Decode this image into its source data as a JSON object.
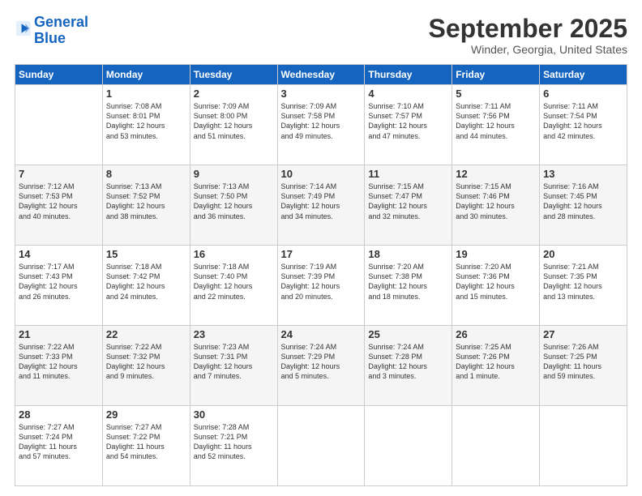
{
  "logo": {
    "line1": "General",
    "line2": "Blue"
  },
  "title": "September 2025",
  "subtitle": "Winder, Georgia, United States",
  "weekdays": [
    "Sunday",
    "Monday",
    "Tuesday",
    "Wednesday",
    "Thursday",
    "Friday",
    "Saturday"
  ],
  "weeks": [
    [
      {
        "num": "",
        "info": ""
      },
      {
        "num": "1",
        "info": "Sunrise: 7:08 AM\nSunset: 8:01 PM\nDaylight: 12 hours\nand 53 minutes."
      },
      {
        "num": "2",
        "info": "Sunrise: 7:09 AM\nSunset: 8:00 PM\nDaylight: 12 hours\nand 51 minutes."
      },
      {
        "num": "3",
        "info": "Sunrise: 7:09 AM\nSunset: 7:58 PM\nDaylight: 12 hours\nand 49 minutes."
      },
      {
        "num": "4",
        "info": "Sunrise: 7:10 AM\nSunset: 7:57 PM\nDaylight: 12 hours\nand 47 minutes."
      },
      {
        "num": "5",
        "info": "Sunrise: 7:11 AM\nSunset: 7:56 PM\nDaylight: 12 hours\nand 44 minutes."
      },
      {
        "num": "6",
        "info": "Sunrise: 7:11 AM\nSunset: 7:54 PM\nDaylight: 12 hours\nand 42 minutes."
      }
    ],
    [
      {
        "num": "7",
        "info": "Sunrise: 7:12 AM\nSunset: 7:53 PM\nDaylight: 12 hours\nand 40 minutes."
      },
      {
        "num": "8",
        "info": "Sunrise: 7:13 AM\nSunset: 7:52 PM\nDaylight: 12 hours\nand 38 minutes."
      },
      {
        "num": "9",
        "info": "Sunrise: 7:13 AM\nSunset: 7:50 PM\nDaylight: 12 hours\nand 36 minutes."
      },
      {
        "num": "10",
        "info": "Sunrise: 7:14 AM\nSunset: 7:49 PM\nDaylight: 12 hours\nand 34 minutes."
      },
      {
        "num": "11",
        "info": "Sunrise: 7:15 AM\nSunset: 7:47 PM\nDaylight: 12 hours\nand 32 minutes."
      },
      {
        "num": "12",
        "info": "Sunrise: 7:15 AM\nSunset: 7:46 PM\nDaylight: 12 hours\nand 30 minutes."
      },
      {
        "num": "13",
        "info": "Sunrise: 7:16 AM\nSunset: 7:45 PM\nDaylight: 12 hours\nand 28 minutes."
      }
    ],
    [
      {
        "num": "14",
        "info": "Sunrise: 7:17 AM\nSunset: 7:43 PM\nDaylight: 12 hours\nand 26 minutes."
      },
      {
        "num": "15",
        "info": "Sunrise: 7:18 AM\nSunset: 7:42 PM\nDaylight: 12 hours\nand 24 minutes."
      },
      {
        "num": "16",
        "info": "Sunrise: 7:18 AM\nSunset: 7:40 PM\nDaylight: 12 hours\nand 22 minutes."
      },
      {
        "num": "17",
        "info": "Sunrise: 7:19 AM\nSunset: 7:39 PM\nDaylight: 12 hours\nand 20 minutes."
      },
      {
        "num": "18",
        "info": "Sunrise: 7:20 AM\nSunset: 7:38 PM\nDaylight: 12 hours\nand 18 minutes."
      },
      {
        "num": "19",
        "info": "Sunrise: 7:20 AM\nSunset: 7:36 PM\nDaylight: 12 hours\nand 15 minutes."
      },
      {
        "num": "20",
        "info": "Sunrise: 7:21 AM\nSunset: 7:35 PM\nDaylight: 12 hours\nand 13 minutes."
      }
    ],
    [
      {
        "num": "21",
        "info": "Sunrise: 7:22 AM\nSunset: 7:33 PM\nDaylight: 12 hours\nand 11 minutes."
      },
      {
        "num": "22",
        "info": "Sunrise: 7:22 AM\nSunset: 7:32 PM\nDaylight: 12 hours\nand 9 minutes."
      },
      {
        "num": "23",
        "info": "Sunrise: 7:23 AM\nSunset: 7:31 PM\nDaylight: 12 hours\nand 7 minutes."
      },
      {
        "num": "24",
        "info": "Sunrise: 7:24 AM\nSunset: 7:29 PM\nDaylight: 12 hours\nand 5 minutes."
      },
      {
        "num": "25",
        "info": "Sunrise: 7:24 AM\nSunset: 7:28 PM\nDaylight: 12 hours\nand 3 minutes."
      },
      {
        "num": "26",
        "info": "Sunrise: 7:25 AM\nSunset: 7:26 PM\nDaylight: 12 hours\nand 1 minute."
      },
      {
        "num": "27",
        "info": "Sunrise: 7:26 AM\nSunset: 7:25 PM\nDaylight: 11 hours\nand 59 minutes."
      }
    ],
    [
      {
        "num": "28",
        "info": "Sunrise: 7:27 AM\nSunset: 7:24 PM\nDaylight: 11 hours\nand 57 minutes."
      },
      {
        "num": "29",
        "info": "Sunrise: 7:27 AM\nSunset: 7:22 PM\nDaylight: 11 hours\nand 54 minutes."
      },
      {
        "num": "30",
        "info": "Sunrise: 7:28 AM\nSunset: 7:21 PM\nDaylight: 11 hours\nand 52 minutes."
      },
      {
        "num": "",
        "info": ""
      },
      {
        "num": "",
        "info": ""
      },
      {
        "num": "",
        "info": ""
      },
      {
        "num": "",
        "info": ""
      }
    ]
  ]
}
